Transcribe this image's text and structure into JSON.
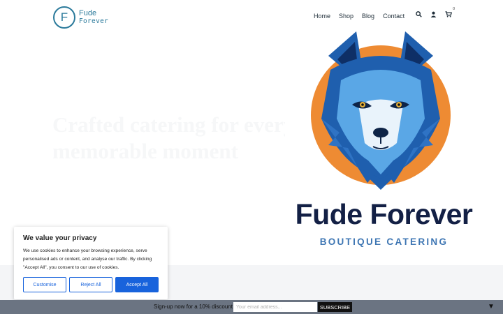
{
  "header": {
    "logo": {
      "letter": "F",
      "line1": "Fude",
      "line2": "Forever"
    },
    "nav": [
      {
        "label": "Home"
      },
      {
        "label": "Shop"
      },
      {
        "label": "Blog"
      },
      {
        "label": "Contact"
      }
    ],
    "icons": {
      "search": "search-icon",
      "account": "user-icon",
      "cart": "cart-icon"
    },
    "cart_count": "0"
  },
  "hero": {
    "title": "Crafted catering for every memorable moment",
    "image": {
      "brand_name": "Fude Forever",
      "brand_sub": "BOUTIQUE CATERING",
      "colors": {
        "sun": "#ee8b33",
        "wolf_dark": "#1f5fae",
        "wolf_light": "#5aa7e6",
        "text": "#132045",
        "sub": "#3e76b3"
      }
    }
  },
  "cookie": {
    "title": "We value your privacy",
    "body": "We use cookies to enhance your browsing experience, serve personalised ads or content, and analyse our traffic. By clicking \"Accept All\", you consent to our use of cookies.",
    "customise": "Customise",
    "reject": "Reject All",
    "accept": "Accept All",
    "accent": "#1863dc"
  },
  "signup": {
    "text": "Sign-up now for a 10% discount",
    "placeholder": "Your email address...",
    "button": "SUBSCRIBE",
    "toggle": "▼"
  }
}
